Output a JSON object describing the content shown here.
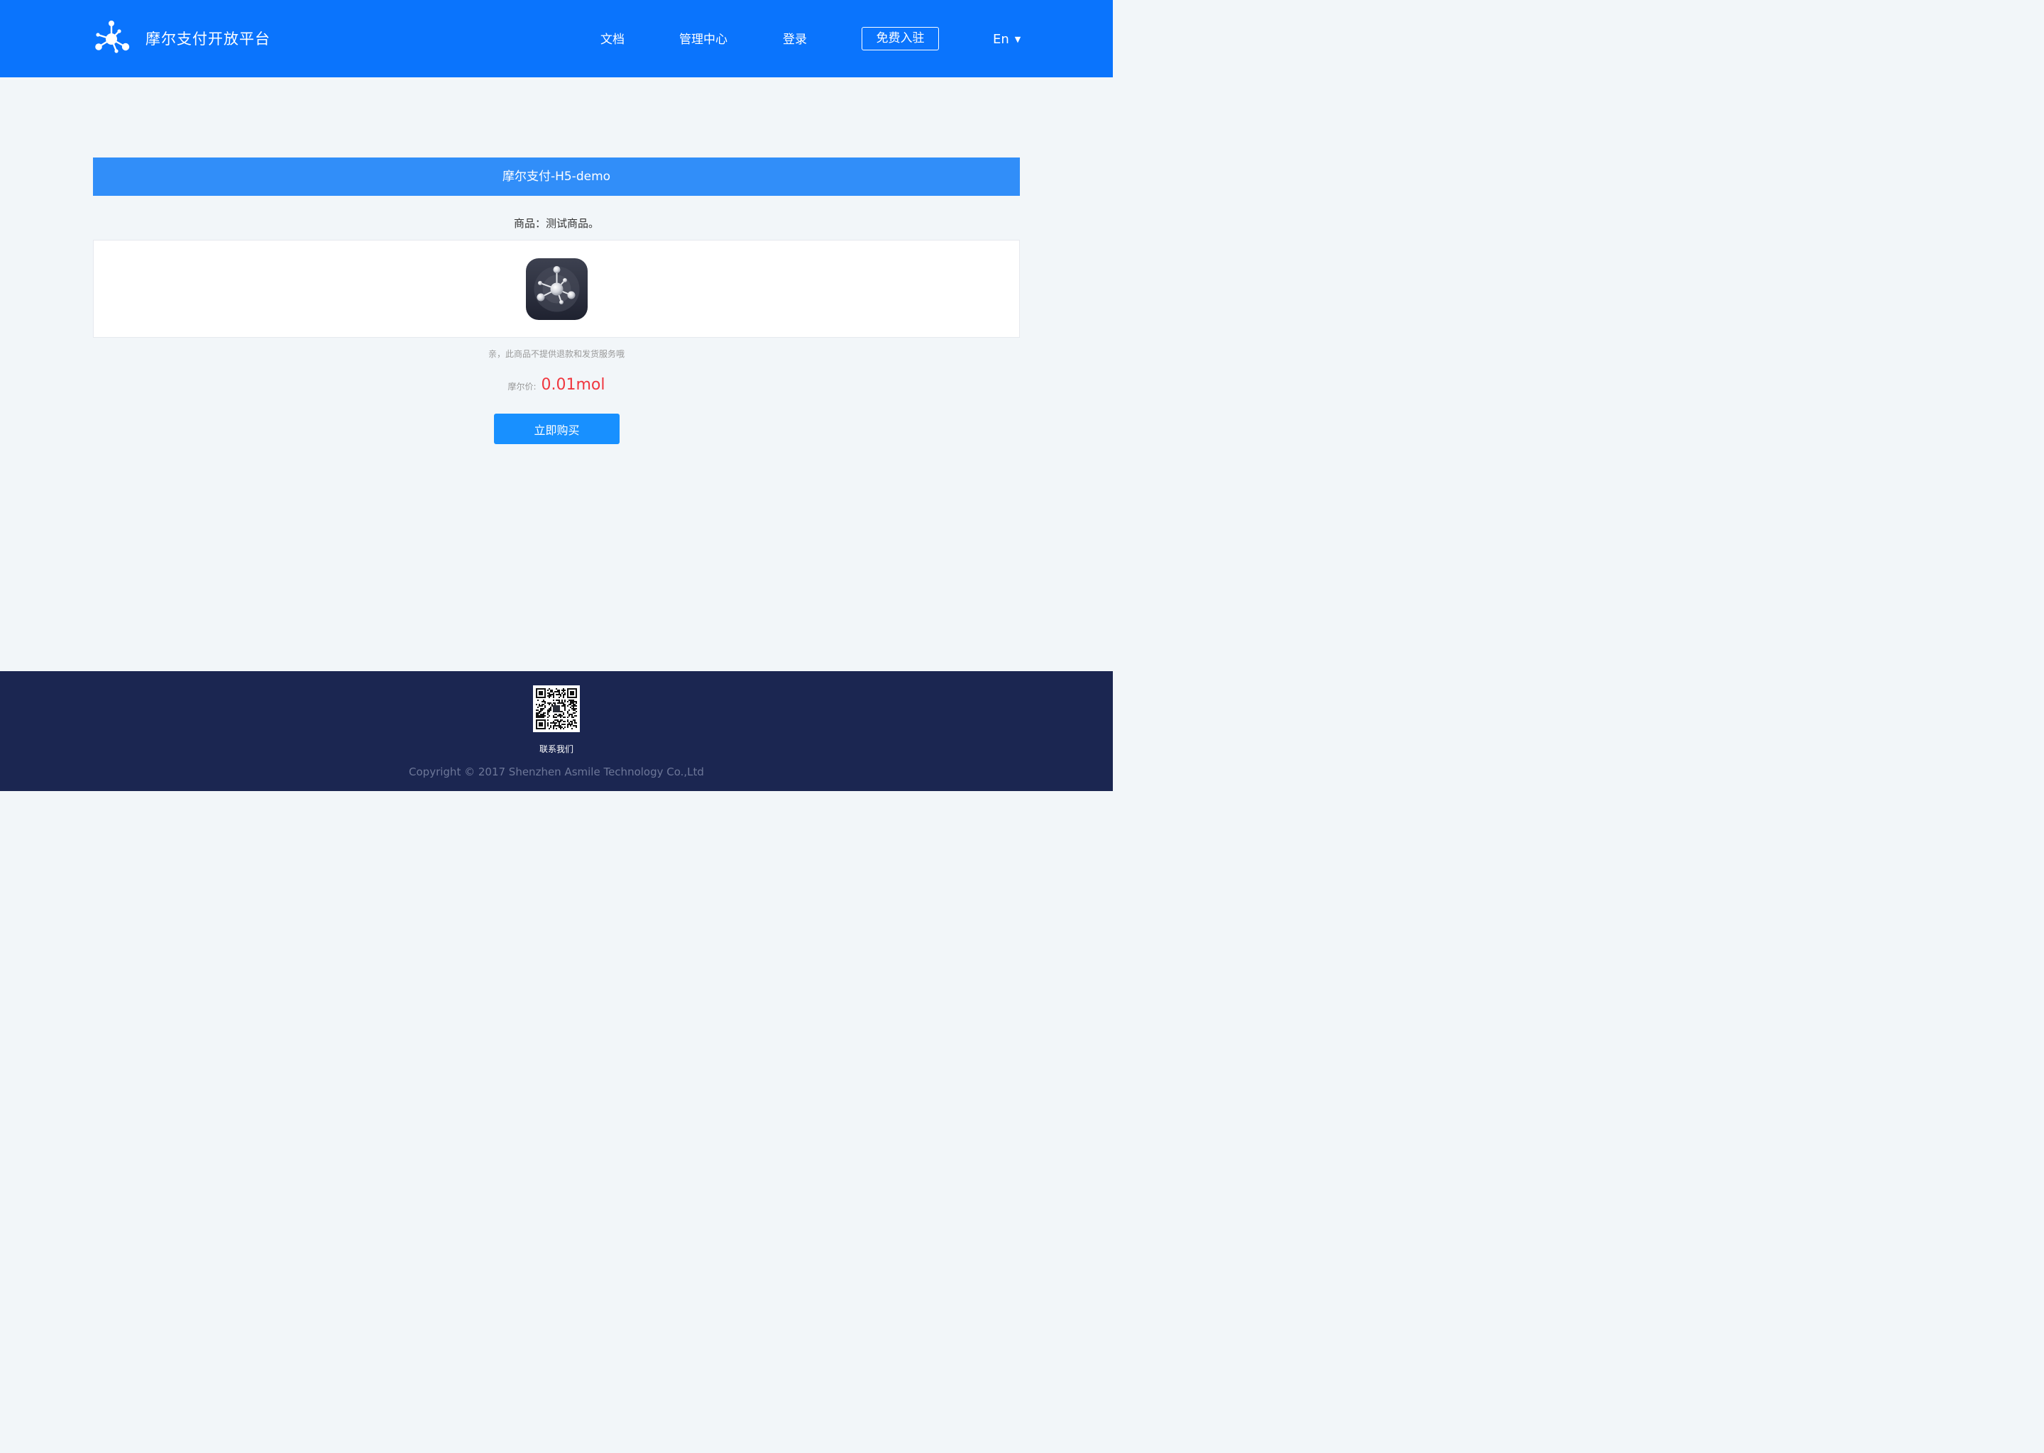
{
  "header": {
    "brand_title": "摩尔支付开放平台",
    "logo_icon": "molecule-logo-icon",
    "nav": {
      "docs": "文档",
      "admin": "管理中心",
      "login": "登录",
      "join": "免费入驻",
      "language": "En",
      "language_caret": "▼"
    }
  },
  "main": {
    "title": "摩尔支付-H5-demo",
    "product_line": "商品：测试商品。",
    "product_icon": "molecule-app-icon",
    "notice": "亲，此商品不提供退款和发货服务哦",
    "price_label": "摩尔价:",
    "price_value": "0.01mol",
    "buy_button": "立即购买"
  },
  "footer": {
    "qr_icon": "qr-code-icon",
    "contact": "联系我们",
    "copyright": "Copyright © 2017 Shenzhen Asmile Technology Co.,Ltd"
  },
  "colors": {
    "header_bg": "#0a74fd",
    "title_bar_bg": "#318ef9",
    "page_bg": "#f2f6f9",
    "price": "#f0373f",
    "button_bg": "#1890ff",
    "footer_bg": "#1b2651",
    "footer_text_muted": "#6d7798"
  }
}
